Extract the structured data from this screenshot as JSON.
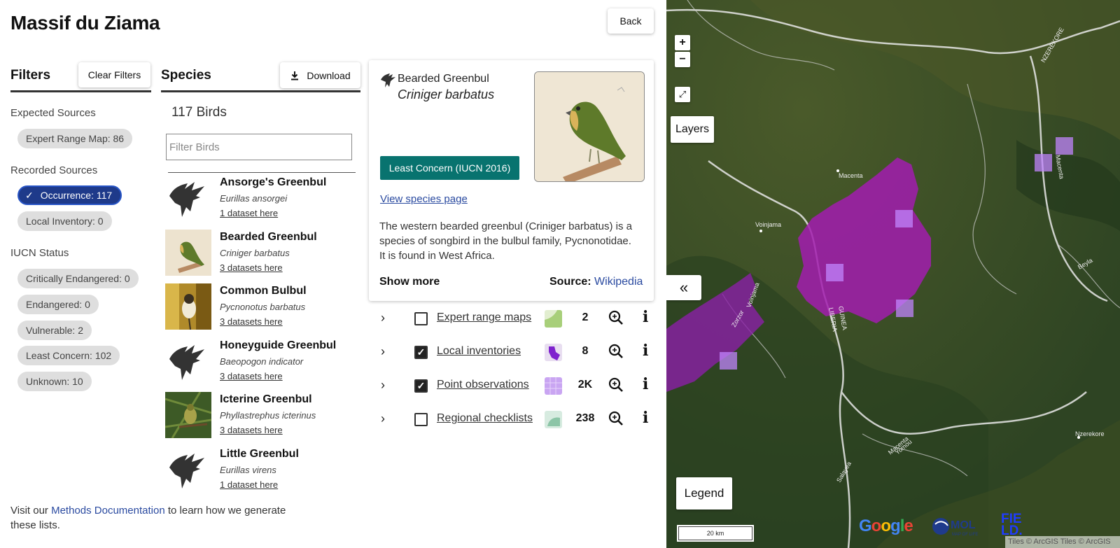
{
  "page": {
    "title": "Massif du Ziama",
    "back_label": "Back"
  },
  "filters": {
    "heading": "Filters",
    "clear_label": "Clear Filters",
    "expected_heading": "Expected Sources",
    "expected": [
      {
        "label": "Expert Range Map: 86",
        "selected": false
      }
    ],
    "recorded_heading": "Recorded Sources",
    "recorded": [
      {
        "label": "Occurrence: 117",
        "selected": true
      },
      {
        "label": "Local Inventory: 0",
        "selected": false
      }
    ],
    "iucn_heading": "IUCN Status",
    "iucn": [
      {
        "label": "Critically Endangered: 0"
      },
      {
        "label": "Endangered: 0"
      },
      {
        "label": "Vulnerable: 2"
      },
      {
        "label": "Least Concern: 102"
      },
      {
        "label": "Unknown: 10"
      }
    ]
  },
  "species": {
    "heading": "Species",
    "download_label": "Download",
    "count": "117 Birds",
    "filter_placeholder": "Filter Birds",
    "items": [
      {
        "name": "Ansorge's Greenbul",
        "sci": "Eurillas ansorgei",
        "datasets": "1 dataset here",
        "thumb": "silhouette"
      },
      {
        "name": "Bearded Greenbul",
        "sci": "Criniger barbatus",
        "datasets": "3 datasets here",
        "thumb": "bearded"
      },
      {
        "name": "Common Bulbul",
        "sci": "Pycnonotus barbatus",
        "datasets": "3 datasets here",
        "thumb": "common"
      },
      {
        "name": "Honeyguide Greenbul",
        "sci": "Baeopogon indicator",
        "datasets": "3 datasets here",
        "thumb": "silhouette"
      },
      {
        "name": "Icterine Greenbul",
        "sci": "Phyllastrephus icterinus",
        "datasets": "3 datasets here",
        "thumb": "icterine"
      },
      {
        "name": "Little Greenbul",
        "sci": "Eurillas virens",
        "datasets": "1 dataset here",
        "thumb": "silhouette"
      }
    ]
  },
  "detail": {
    "common_name": "Bearded Greenbul",
    "sci_name": "Criniger barbatus",
    "status": "Least Concern (IUCN 2016)",
    "view_link": "View species page",
    "description": "The western bearded greenbul (Criniger barbatus) is a species of songbird in the bulbul family, Pycnonotidae. It is found in West Africa.",
    "show_more": "Show more",
    "source_label": "Source:",
    "source_link": "Wikipedia",
    "layers": [
      {
        "label": "Expert range maps",
        "checked": false,
        "count": "2",
        "swatch": "range"
      },
      {
        "label": "Local inventories",
        "checked": true,
        "count": "8",
        "swatch": "local"
      },
      {
        "label": "Point observations",
        "checked": true,
        "count": "2K",
        "swatch": "points"
      },
      {
        "label": "Regional checklists",
        "checked": false,
        "count": "238",
        "swatch": "regional"
      }
    ]
  },
  "footer": {
    "pre": "Visit our ",
    "link": "Methods Documentation",
    "post": " to learn how we generate these lists."
  },
  "map": {
    "zoom_in": "+",
    "zoom_out": "−",
    "fullscreen": "⤢",
    "layers_label": "Layers",
    "collapse": "«",
    "legend_label": "Legend",
    "scale": "20 km",
    "attribution": "Tiles © ArcGIS Tiles © ArcGIS",
    "places": [
      "Macenta",
      "Voinjama",
      "Nzerekore",
      "Macenta",
      "NZEREKORE",
      "LIBERIA",
      "GUINEA",
      "Zorzor",
      "Voinjama",
      "Beyla",
      "Macenta",
      "Yomou",
      "Salayea"
    ],
    "logos": [
      "Google",
      "MOL",
      "MAP OF LIFE",
      "FIELD"
    ],
    "colors": {
      "range": "#a21caf",
      "points": "#c084fc",
      "base": "#2f4a24"
    }
  }
}
